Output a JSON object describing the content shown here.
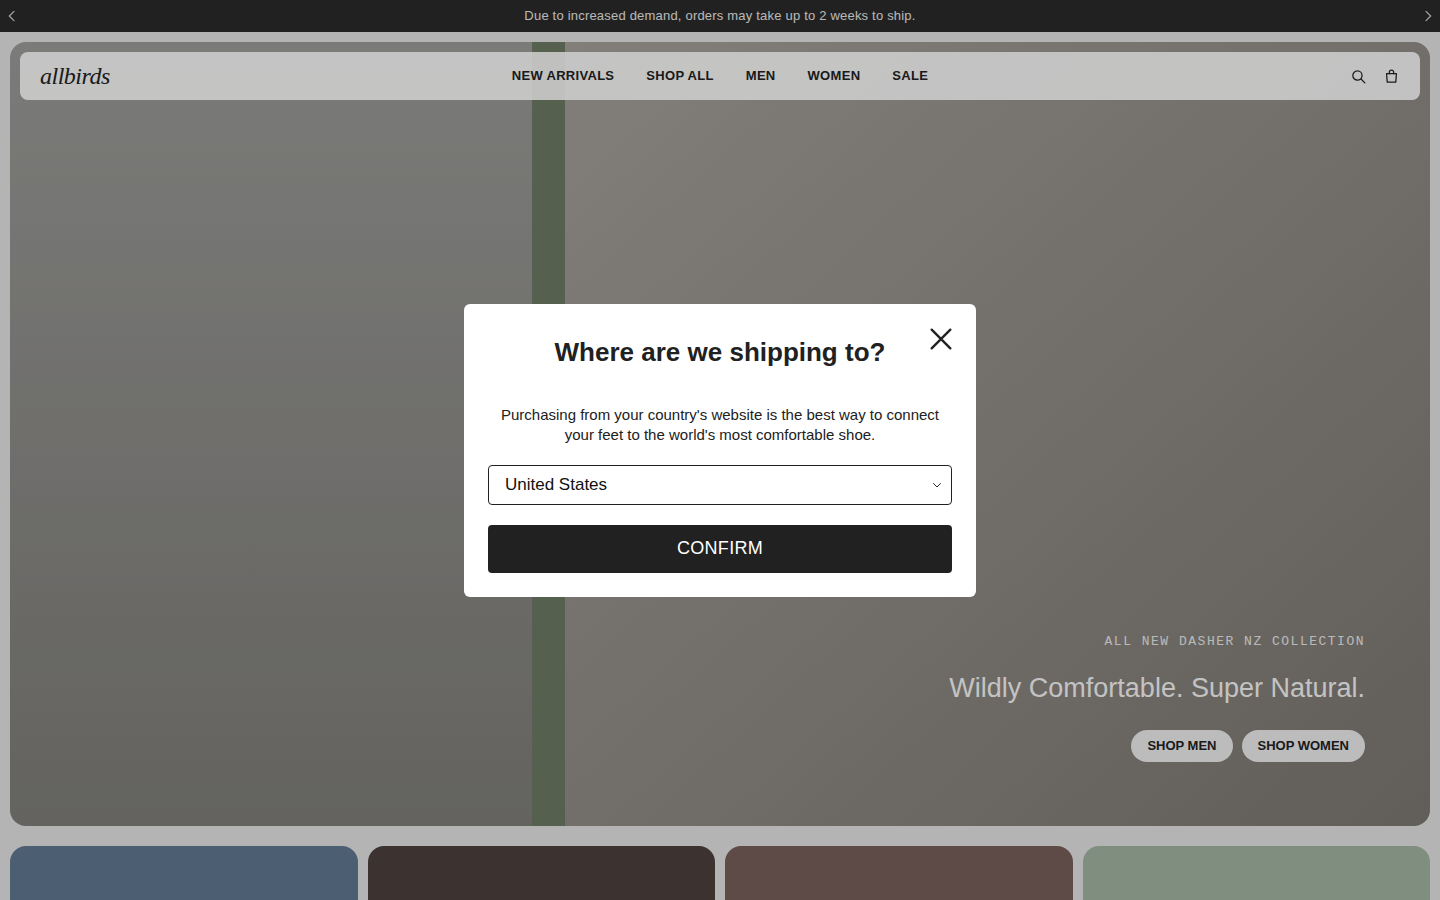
{
  "announcement": {
    "text": "Due to increased demand, orders may take up to 2 weeks to ship."
  },
  "nav": {
    "logo": "allbirds",
    "links": [
      "NEW ARRIVALS",
      "SHOP ALL",
      "MEN",
      "WOMEN",
      "SALE"
    ]
  },
  "hero": {
    "eyebrow": "ALL NEW DASHER NZ COLLECTION",
    "headline": "Wildly Comfortable. Super Natural.",
    "buttons": [
      "SHOP MEN",
      "SHOP WOMEN"
    ]
  },
  "categories": [
    {
      "color": "#5e768f"
    },
    {
      "color": "#4b403e"
    },
    {
      "color": "#765e5a"
    },
    {
      "color": "#a1b2a0"
    }
  ],
  "modal": {
    "title": "Where are we shipping to?",
    "body": "Purchasing from your country's website is the best way to connect your feet to the world's most comfortable shoe.",
    "country": "United States",
    "confirm": "CONFIRM"
  }
}
